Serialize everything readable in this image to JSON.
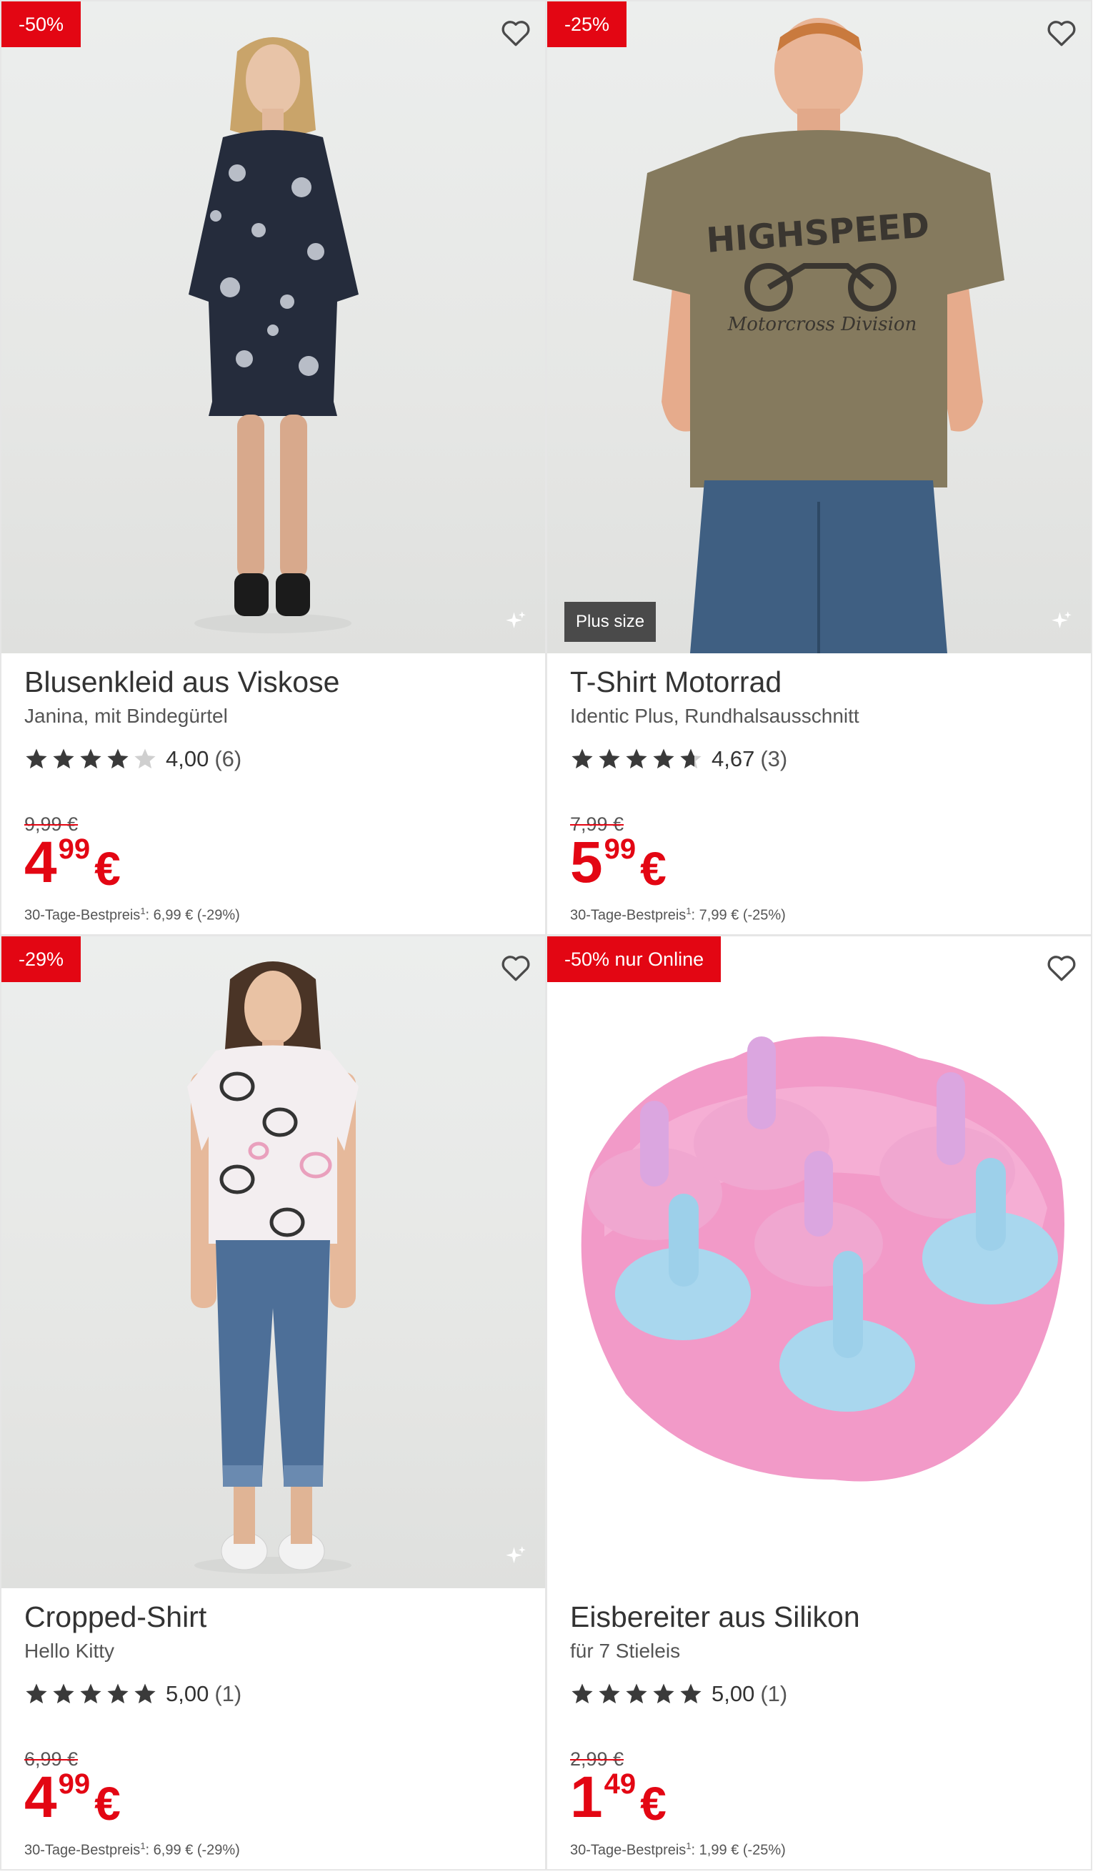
{
  "products": [
    {
      "badge": "-50%",
      "title": "Blusenkleid aus Viskose",
      "subtitle": "Janina, mit Bindegürtel",
      "rating_value": "4,00",
      "rating_count": "(6)",
      "stars": 4.0,
      "old_price": "9,99 €",
      "price_euros": "4",
      "price_cents": "99",
      "currency": "€",
      "best_price_label": "30-Tage-Bestpreis",
      "best_price_sup": "1",
      "best_price_value": ": 6,99 € (-29%)",
      "wishlist_icon": "heart-outline-icon"
    },
    {
      "badge": "-25%",
      "tag": "Plus size",
      "title": "T-Shirt Motorrad",
      "subtitle": "Identic Plus, Rundhalsausschnitt",
      "rating_value": "4,67",
      "rating_count": "(3)",
      "stars": 4.67,
      "old_price": "7,99 €",
      "price_euros": "5",
      "price_cents": "99",
      "currency": "€",
      "best_price_label": "30-Tage-Bestpreis",
      "best_price_sup": "1",
      "best_price_value": ": 7,99 € (-25%)",
      "shirt_print": "HIGHSPEED",
      "shirt_print_sub": "Motorcross Division",
      "wishlist_icon": "heart-outline-icon"
    },
    {
      "badge": "-29%",
      "title": "Cropped-Shirt",
      "subtitle": "Hello Kitty",
      "rating_value": "5,00",
      "rating_count": "(1)",
      "stars": 5.0,
      "old_price": "6,99 €",
      "price_euros": "4",
      "price_cents": "99",
      "currency": "€",
      "best_price_label": "30-Tage-Bestpreis",
      "best_price_sup": "1",
      "best_price_value": ": 6,99 € (-29%)",
      "wishlist_icon": "heart-outline-icon"
    },
    {
      "badge": "-50% nur Online",
      "title": "Eisbereiter aus Silikon",
      "subtitle": "für 7 Stieleis",
      "rating_value": "5,00",
      "rating_count": "(1)",
      "stars": 5.0,
      "old_price": "2,99 €",
      "price_euros": "1",
      "price_cents": "49",
      "currency": "€",
      "best_price_label": "30-Tage-Bestpreis",
      "best_price_sup": "1",
      "best_price_value": ": 1,99 € (-25%)",
      "wishlist_icon": "heart-outline-icon"
    }
  ],
  "colors": {
    "accent_red": "#e30613",
    "star_filled": "#3a3a3a",
    "star_empty": "#cfcfcf",
    "plus_tag_bg": "#4a4a4a"
  }
}
